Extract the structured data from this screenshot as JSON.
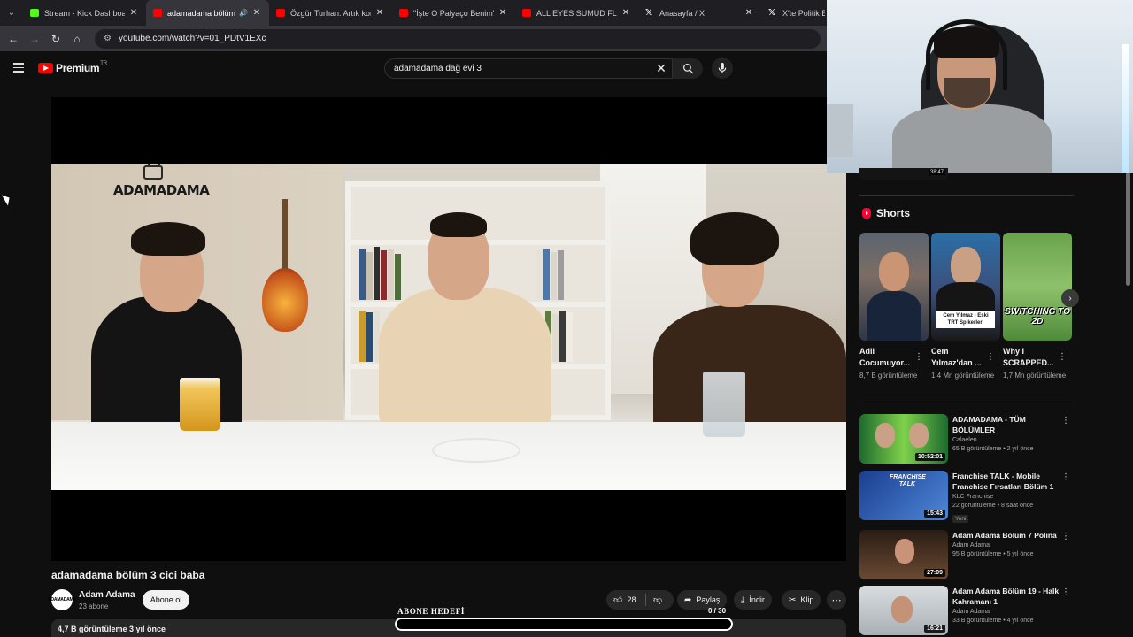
{
  "browser": {
    "tabs": [
      {
        "title": "Stream - Kick Dashboard",
        "favicon_color": "#53fc18",
        "active": false
      },
      {
        "title": "adamadama bölüm 3",
        "favicon_color": "#ff0000",
        "active": true,
        "audio": true
      },
      {
        "title": "Özgür Turhan: Artık kome",
        "favicon_color": "#ff0000",
        "active": false
      },
      {
        "title": "\"İşte O Palyaço Benim\" Kı",
        "favicon_color": "#ff0000",
        "active": false
      },
      {
        "title": "ALL EYES SUMUD FLOTILL",
        "favicon_color": "#ff0000",
        "active": false
      },
      {
        "title": "Anasayfa / X",
        "favicon_color": "#ffffff",
        "active": false
      },
      {
        "title": "X'te Politik Edits",
        "favicon_color": "#ffffff",
        "active": false
      }
    ],
    "url": "youtube.com/watch?v=01_PDtV1EXc"
  },
  "youtube": {
    "logo_text": "Premium",
    "region": "TR",
    "search_query": "adamadama dağ evi 3"
  },
  "video": {
    "title": "adamadama bölüm 3 cici baba",
    "watermark": "ADAMADAMA",
    "channel_avatar_text": "ADAMADAMA",
    "channel_name": "Adam Adama",
    "subscribers": "23 abone",
    "subscribe_label": "Abone ol",
    "likes": "28",
    "share_label": "Paylaş",
    "download_label": "İndir",
    "clip_label": "Klip",
    "description_summary": "4,7 B görüntüleme  3 yıl önce"
  },
  "goal_overlay": {
    "label": "ABONE HEDEFİ",
    "current": 0,
    "target": 30,
    "count_text": "0  /  30",
    "progress": 0
  },
  "sidebar": {
    "top_thumb_duration": "38:47",
    "shorts_title": "Shorts",
    "shorts": [
      {
        "title": "Adil Cocumuyor...",
        "views": "8,7 B görüntüleme"
      },
      {
        "title": "Cem Yılmaz'dan ...",
        "views": "1,4 Mn görüntüleme",
        "caption": "Cem Yılmaz - Eski TRT Spikerleri"
      },
      {
        "title": "Why I SCRAPPED...",
        "views": "1,7 Mn görüntüleme",
        "caption": "SWITCHING TO 2D"
      }
    ],
    "recommendations": [
      {
        "title": "ADAMADAMA - TÜM BÖLÜMLER",
        "channel": "Calaelen",
        "meta": "65 B görüntüleme • 2 yıl önce",
        "duration": "10:52:01",
        "badge": ""
      },
      {
        "title": "Franchise TALK - Mobile Franchise Fırsatları Bölüm 1",
        "channel": "KLC Franchise",
        "meta": "22 görüntüleme • 8 saat önce",
        "duration": "15:43",
        "badge": "Yeni",
        "thumb_text": "FRANCHISE TALK"
      },
      {
        "title": "Adam Adama Bölüm 7 Polina",
        "channel": "Adam Adama",
        "meta": "95 B görüntüleme • 5 yıl önce",
        "duration": "27:09",
        "badge": ""
      },
      {
        "title": "Adam Adama Bölüm 19 - Halk Kahramanı 1",
        "channel": "Adam Adama",
        "meta": "33 B görüntüleme • 4 yıl önce",
        "duration": "16:21",
        "badge": ""
      }
    ]
  },
  "colors": {
    "background": "#0f0f0f",
    "youtube_red": "#ff0000",
    "pill": "#272727",
    "text": "#f1f1f1",
    "muted": "#aaaaaa"
  }
}
